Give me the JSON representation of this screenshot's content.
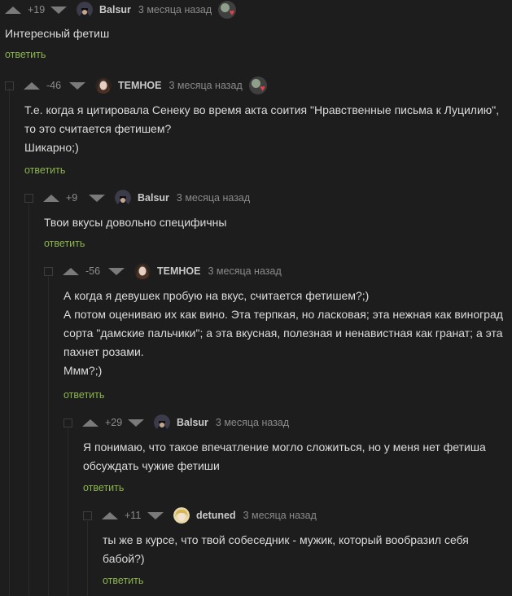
{
  "colors": {
    "background": "#1d1d1d",
    "reply": "#8bb54e",
    "award_heart": "#e0424b"
  },
  "comments": [
    {
      "score": "+19",
      "author": "Balsur",
      "time": "3 месяца назад",
      "avatar": "hood-avatar-icon",
      "text": "Интересный фетиш",
      "reply": "ответить",
      "has_award": true
    },
    {
      "score": "-46",
      "author": "ТЕМНОЕ",
      "time": "3 месяца назад",
      "avatar": "girl-avatar-icon",
      "text": "Т.е. когда я цитировала Сенеку во время акта соития \"Нравственные письма к Луцилию\",\nто это считается фетишем?\nШикарно;)",
      "reply": "ответить",
      "has_award": true
    },
    {
      "score": "+9",
      "author": "Balsur",
      "time": "3 месяца назад",
      "avatar": "hood-avatar-icon",
      "text": "Твои вкусы довольно специфичны",
      "reply": "ответить",
      "has_award": false
    },
    {
      "score": "-56",
      "author": "ТЕМНОЕ",
      "time": "3 месяца назад",
      "avatar": "girl-avatar-icon",
      "text": "А когда я девушек пробую на вкус, считается фетишем?;)\nА потом оцениваю их как вино. Эта терпкая, но ласковая; эта нежная как виноград\nсорта \"дамские пальчики\"; а эта вкусная, полезная и ненавистная как гранат; а эта\nпахнет розами.\nМмм?;)",
      "reply": "ответить",
      "has_award": false
    },
    {
      "score": "+29",
      "author": "Balsur",
      "time": "3 месяца назад",
      "avatar": "hood-avatar-icon",
      "text": "Я понимаю, что такое впечатление могло сложиться, но у меня нет фетиша\nобсуждать чужие фетиши",
      "reply": "ответить",
      "has_award": false
    },
    {
      "score": "+11",
      "author": "detuned",
      "time": "3 месяца назад",
      "avatar": "blond-avatar-icon",
      "text": "ты же в курсе, что твой собеседник - мужик, который вообразил себя\nбабой?)",
      "reply": "ответить",
      "has_award": false
    }
  ]
}
